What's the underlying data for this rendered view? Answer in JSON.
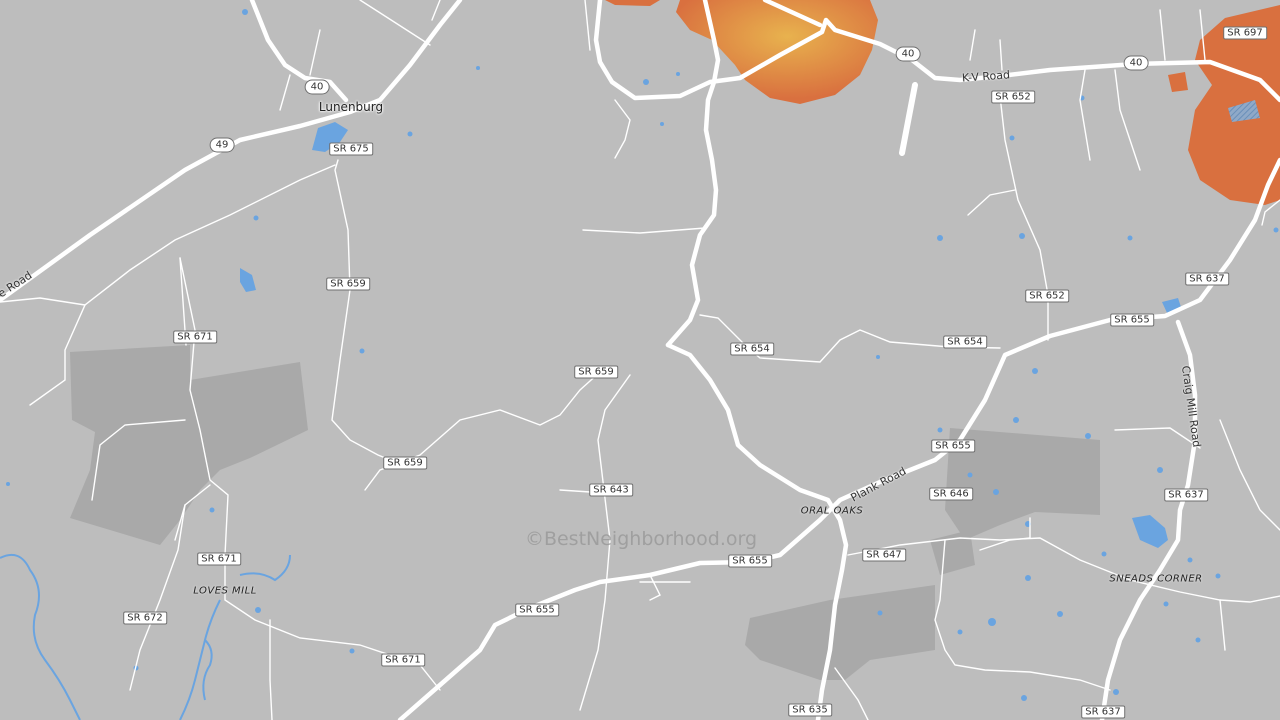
{
  "map": {
    "watermark": "©BestNeighborhood.org",
    "colors": {
      "land": "#bdbdbd",
      "road": "#ffffff",
      "water": "#6aa4e0",
      "parcel": "#a9a9a9",
      "heat_high": "#e8b24e",
      "heat_low": "#d9703f"
    },
    "towns": {
      "lunenburg": "Lunenburg"
    },
    "places": {
      "oral_oaks": "ORAL OAKS",
      "loves_mill": "LOVES MILL",
      "sneads_corner": "SNEADS CORNER"
    },
    "road_names": {
      "kv_road": "K-V Road",
      "plank_road": "Plank Road",
      "craig_mill_road": "Craig Mill Road",
      "cut_road": "e Road"
    },
    "route_shields": {
      "r40_a": "40",
      "r40_b": "40",
      "r40_c": "40",
      "r49": "49"
    },
    "route_labels": {
      "sr675": "SR 675",
      "sr659_a": "SR 659",
      "sr659_b": "SR 659",
      "sr659_c": "SR 659",
      "sr671_a": "SR 671",
      "sr671_b": "SR 671",
      "sr671_c": "SR 671",
      "sr672": "SR 672",
      "sr643": "SR 643",
      "sr654_a": "SR 654",
      "sr654_b": "SR 654",
      "sr652_a": "SR 652",
      "sr652_b": "SR 652",
      "sr697": "SR 697",
      "sr637_a": "SR 637",
      "sr637_b": "SR 637",
      "sr637_c": "SR 637",
      "sr655_a": "SR 655",
      "sr655_b": "SR 655",
      "sr655_c": "SR 655",
      "sr655_d": "SR 655",
      "sr646": "SR 646",
      "sr647": "SR 647",
      "sr635": "SR 635"
    }
  }
}
